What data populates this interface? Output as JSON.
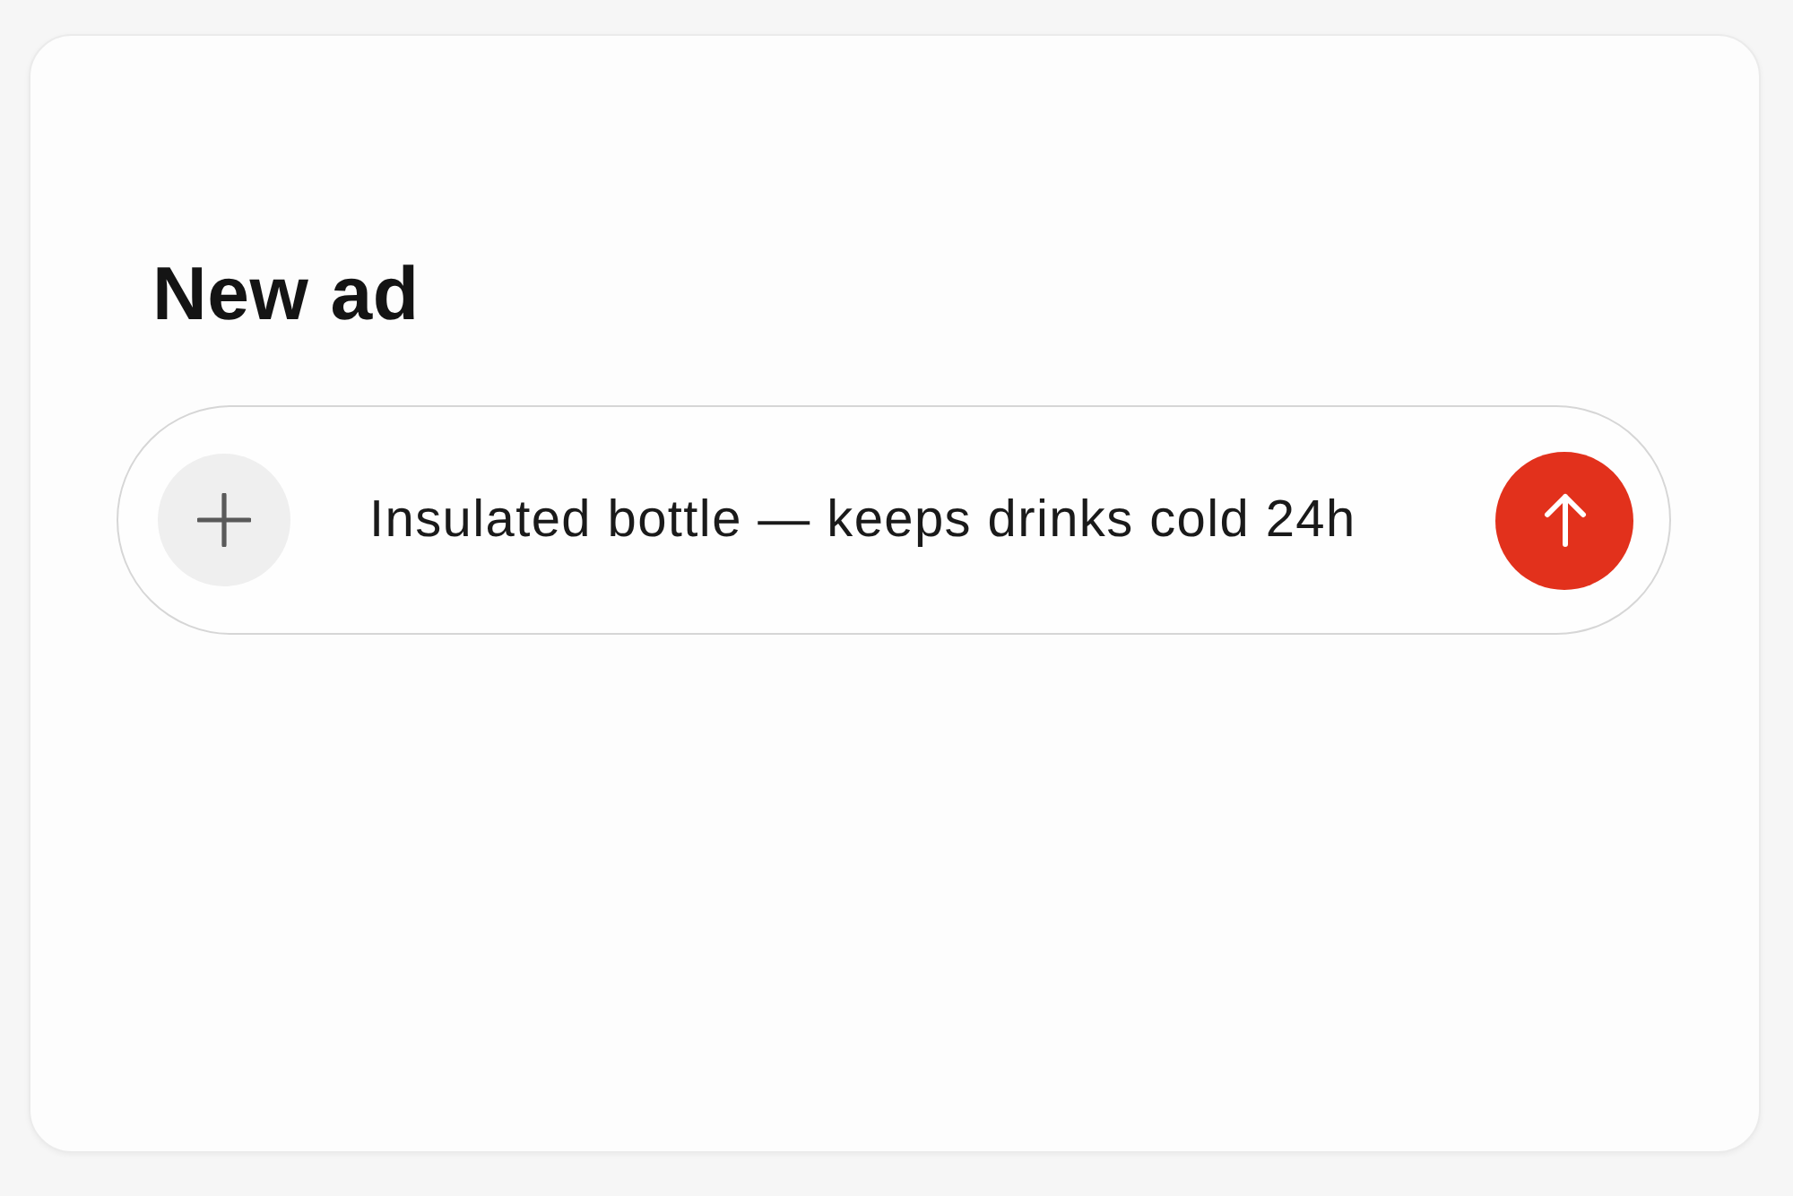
{
  "title": "New ad",
  "composer": {
    "value": "Insulated bottle — keeps drinks cold 24h"
  }
}
